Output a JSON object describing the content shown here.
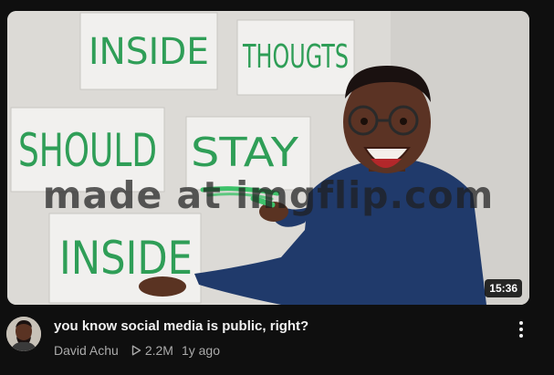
{
  "thumbnail": {
    "signs": [
      "INSIDE",
      "THOUGTS",
      "SHOULD",
      "STAY",
      "INSIDE"
    ],
    "watermark": "made at imgflip.com",
    "duration": "15:36"
  },
  "video": {
    "title": "you know social media is public, right?",
    "channel": "David Achu",
    "views": "2.2M",
    "age": "1y ago"
  },
  "icons": {
    "views": "play-outline-icon",
    "menu": "more-vert-icon"
  },
  "colors": {
    "background": "#0f0f0f",
    "marker_green": "#2f9e57",
    "meta_text": "#aaaaaa"
  }
}
